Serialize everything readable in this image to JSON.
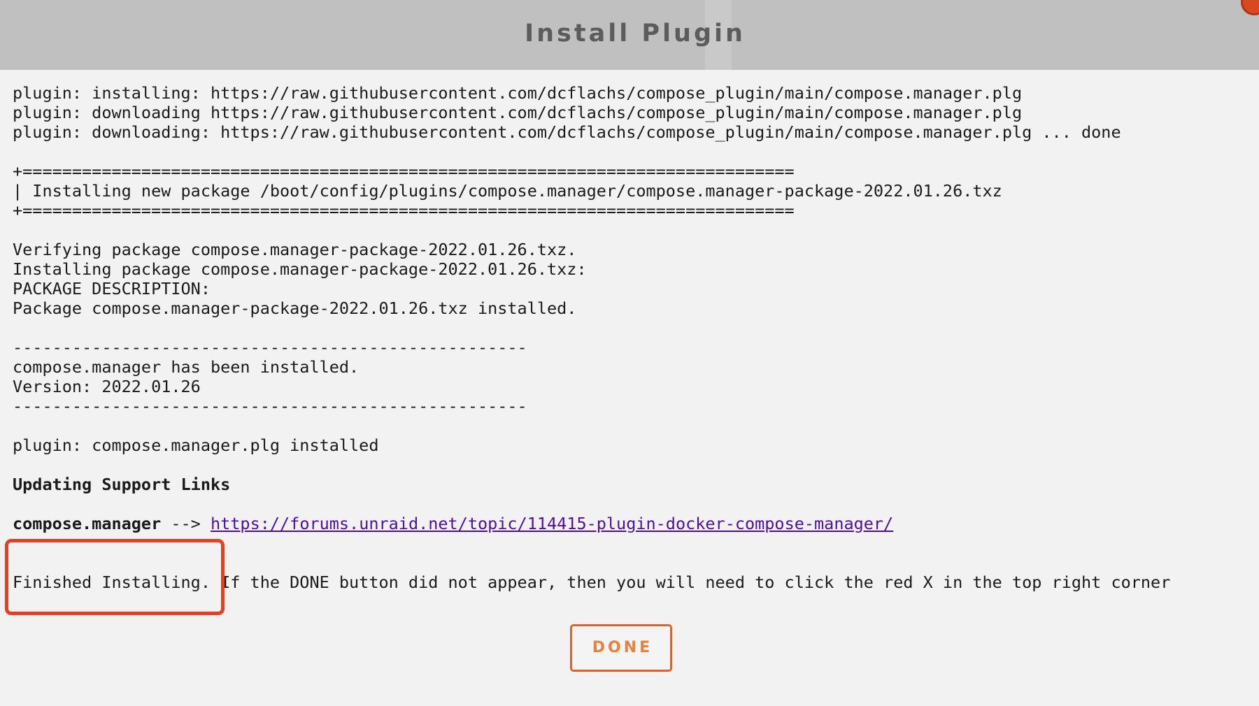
{
  "dialog": {
    "title": "Install Plugin",
    "done_label": "DONE"
  },
  "log": {
    "line_1": "plugin: installing: https://raw.githubusercontent.com/dcflachs/compose_plugin/main/compose.manager.plg",
    "line_2": "plugin: downloading https://raw.githubusercontent.com/dcflachs/compose_plugin/main/compose.manager.plg",
    "line_3": "plugin: downloading: https://raw.githubusercontent.com/dcflachs/compose_plugin/main/compose.manager.plg ... done",
    "separator_eq_top": "+==============================================================================",
    "installing_package": "| Installing new package /boot/config/plugins/compose.manager/compose.manager-package-2022.01.26.txz",
    "separator_eq_bottom": "+==============================================================================",
    "verifying": "Verifying package compose.manager-package-2022.01.26.txz.",
    "installing": "Installing package compose.manager-package-2022.01.26.txz:",
    "package_description": "PACKAGE DESCRIPTION:",
    "package_installed": "Package compose.manager-package-2022.01.26.txz installed.",
    "separator_dash_top": "----------------------------------------------------",
    "has_been_installed": "compose.manager has been installed.",
    "version": "Version: 2022.01.26",
    "separator_dash_bottom": "----------------------------------------------------",
    "plg_installed": "plugin: compose.manager.plg installed",
    "updating_support_links": "Updating Support Links",
    "support_plugin_name": "compose.manager",
    "support_arrow": " --> ",
    "support_link": "https://forums.unraid.net/topic/114415-plugin-docker-compose-manager/",
    "finished": "Finished Installing. If the DONE button did not appear, then you will need to click the red X in the top right corner"
  },
  "colors": {
    "titlebar": "#c0c0c0",
    "background": "#f2f2f2",
    "link": "#4b0fa3",
    "done_accent": "#e8813c",
    "highlight": "#e04226",
    "close_button": "#d9481f"
  }
}
